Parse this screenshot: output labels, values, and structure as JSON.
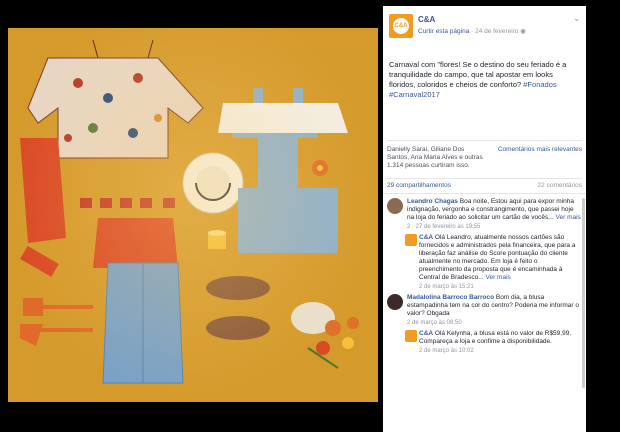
{
  "post": {
    "page_name": "C&A",
    "page_link": "Curtir esta página",
    "date": "24 de fevereiro",
    "text": "Carnaval com \"flores! Se o destino do seu feriado é a tranquilidade do campo, que tal apostar em looks floridos, coloridos e cheios de conforto?",
    "hashtags": "#Fonados #Carnaval2017",
    "likes_names": "Danielly Sarai, Giliane Dos Santos, Ana Maria Alves e outras 1.314 pessoas curtiram isso.",
    "relevant": "Comentários mais relevantes",
    "shares": "29 compartilhamentos",
    "comments_count": "22 comentários"
  },
  "comments": [
    {
      "author": "Leandro Chagas",
      "text": "Boa noite, Estou aqui para expor minha indignação, vergonha e constrangimento, que passei hoje na loja do feriado ao solicitar um cartão de vocês...",
      "more": "Ver mais",
      "time": "2 · 27 de fevereiro às 19:55",
      "reply": {
        "author": "C&A",
        "text": "Olá Leandro, atualmente nossos cartões são fornecidos e administrados pela financeira, que para a liberação faz análise do Score pontuação do cliente atualmente no mercado. Em loja é feito o preenchimento da proposta que é encaminhada à Central de Bradesco...",
        "more": "Ver mais",
        "time": "2 de março às 15:21"
      }
    },
    {
      "author": "Madalolina Barroco Barroco",
      "text": "Bom dia, a blusa estampadinha tem na cor do centro? Poderia me informar o valor? Obgada",
      "more": "",
      "time": "2 de março às 08:50",
      "reply": {
        "author": "C&A",
        "text": "Olá Kelynha, a blusa está no valor de R$59,99. Compareça a loja e confime a disponibilidade.",
        "more": "",
        "time": "2 de março às 10:02"
      }
    }
  ],
  "icons": {
    "chevron": "chevron-down-icon",
    "logo": "ca-logo-icon"
  },
  "colors": {
    "photo_background": "#d49a2c",
    "link": "#365899",
    "brand": "#f29b21"
  }
}
